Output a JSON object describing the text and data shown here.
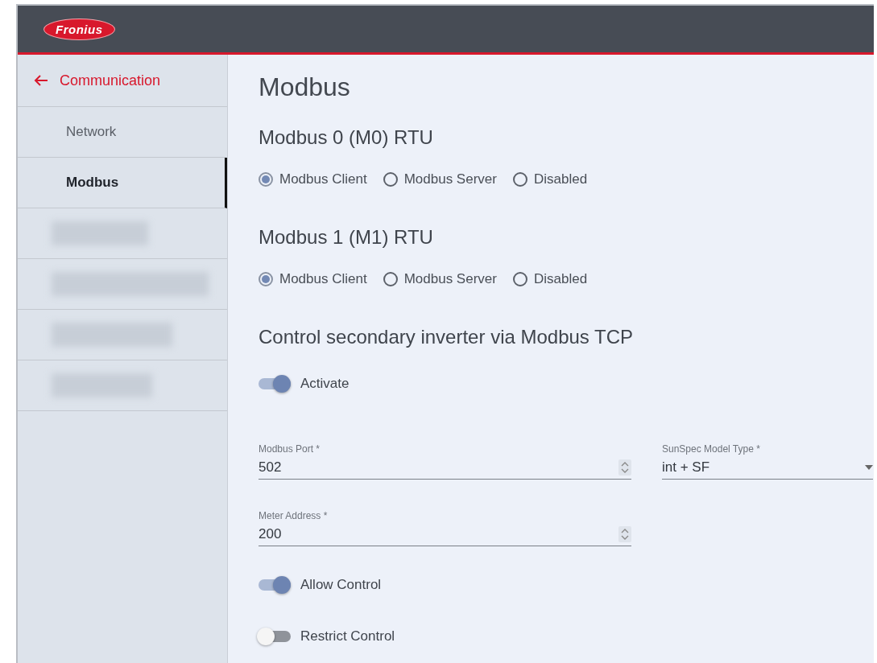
{
  "header": {
    "logo": "Fronius"
  },
  "sidebar": {
    "back": {
      "label": "Communication"
    },
    "items": [
      {
        "kind": "link",
        "label": "Network",
        "selected": false
      },
      {
        "kind": "link",
        "label": "Modbus",
        "selected": true
      },
      {
        "kind": "blurred"
      },
      {
        "kind": "blurred"
      },
      {
        "kind": "blurred"
      },
      {
        "kind": "blurred"
      }
    ]
  },
  "page": {
    "title": "Modbus",
    "rtu_sections": [
      {
        "heading": "Modbus 0 (M0) RTU",
        "options": [
          {
            "label": "Modbus Client",
            "selected": true
          },
          {
            "label": "Modbus Server",
            "selected": false
          },
          {
            "label": "Disabled",
            "selected": false
          }
        ]
      },
      {
        "heading": "Modbus 1 (M1) RTU",
        "options": [
          {
            "label": "Modbus Client",
            "selected": true
          },
          {
            "label": "Modbus Server",
            "selected": false
          },
          {
            "label": "Disabled",
            "selected": false
          }
        ]
      }
    ],
    "tcp": {
      "heading": "Control secondary inverter via Modbus TCP",
      "activate": {
        "label": "Activate",
        "on": true
      },
      "modbus_port": {
        "label": "Modbus Port *",
        "value": "502"
      },
      "sunspec": {
        "label": "SunSpec Model Type *",
        "value": "int + SF"
      },
      "meter_address": {
        "label": "Meter Address *",
        "value": "200"
      },
      "switches": [
        {
          "label": "Allow Control",
          "on": true
        },
        {
          "label": "Restrict Control",
          "on": false
        }
      ]
    }
  }
}
